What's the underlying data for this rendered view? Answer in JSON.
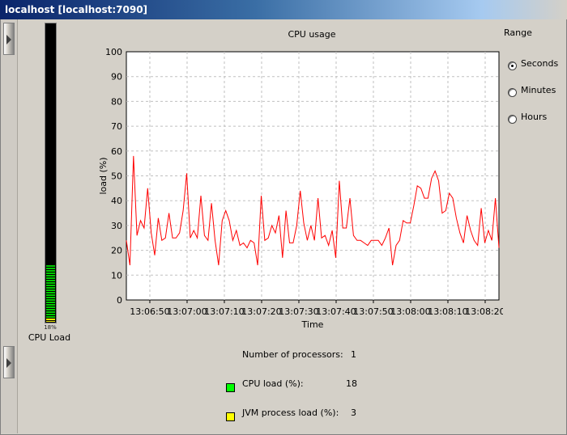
{
  "window": {
    "title": "localhost [localhost:7090]"
  },
  "meter": {
    "percent_label": "18%",
    "label": "CPU Load",
    "cpu_fraction": 0.18,
    "jvm_fraction": 0.03,
    "cpu_color": "#00c800",
    "jvm_color": "#f0f000"
  },
  "range": {
    "title": "Range",
    "options": [
      {
        "label": "Seconds",
        "selected": true
      },
      {
        "label": "Minutes",
        "selected": false
      },
      {
        "label": "Hours",
        "selected": false
      }
    ]
  },
  "stats": {
    "processors_label": "Number of processors:",
    "processors_value": "1",
    "cpu_load_label": "CPU load (%):",
    "cpu_load_value": "18",
    "jvm_load_label": "JVM process load (%):",
    "jvm_load_value": "3",
    "cpu_swatch_color": "#00ff00",
    "jvm_swatch_color": "#ffff00"
  },
  "chart_data": {
    "type": "line",
    "title": "CPU usage",
    "xlabel": "Time",
    "ylabel": "load (%)",
    "ylim": [
      0,
      100
    ],
    "yticks": [
      0,
      10,
      20,
      30,
      40,
      50,
      60,
      70,
      80,
      90,
      100
    ],
    "xlim_seconds": [
      0,
      100
    ],
    "xtick_labels": [
      "13:06:50",
      "13:07:00",
      "13:07:10",
      "13:07:20",
      "13:07:30",
      "13:07:40",
      "13:07:50",
      "13:08:00",
      "13:08:10",
      "13:08:20"
    ],
    "xtick_seconds": [
      6.3,
      16.3,
      26.3,
      36.3,
      46.3,
      56.3,
      66.3,
      76.3,
      86.3,
      96.3
    ],
    "grid": true,
    "line_color": "#ff0000",
    "series": [
      {
        "values": [
          24,
          14,
          58,
          26,
          32,
          29,
          45,
          27,
          18,
          33,
          24,
          25,
          35,
          25,
          25,
          27,
          36,
          51,
          25,
          28,
          25,
          42,
          26,
          24,
          39,
          24,
          14,
          32,
          36,
          32,
          24,
          28,
          22,
          23,
          21,
          24,
          23,
          14,
          42,
          24,
          25,
          30,
          27,
          34,
          17,
          36,
          23,
          23,
          30,
          44,
          31,
          24,
          30,
          24,
          41,
          25,
          26,
          22,
          28,
          17,
          48,
          29,
          29,
          41,
          26,
          24,
          24,
          23,
          22,
          24,
          24,
          24,
          22,
          25,
          29,
          14,
          22,
          24,
          32,
          31,
          31,
          38,
          46,
          45,
          41,
          41,
          49,
          52,
          48,
          35,
          36,
          43,
          41,
          33,
          27,
          23,
          34,
          28,
          24,
          22,
          37,
          23,
          28,
          24,
          41,
          21
        ]
      }
    ]
  }
}
